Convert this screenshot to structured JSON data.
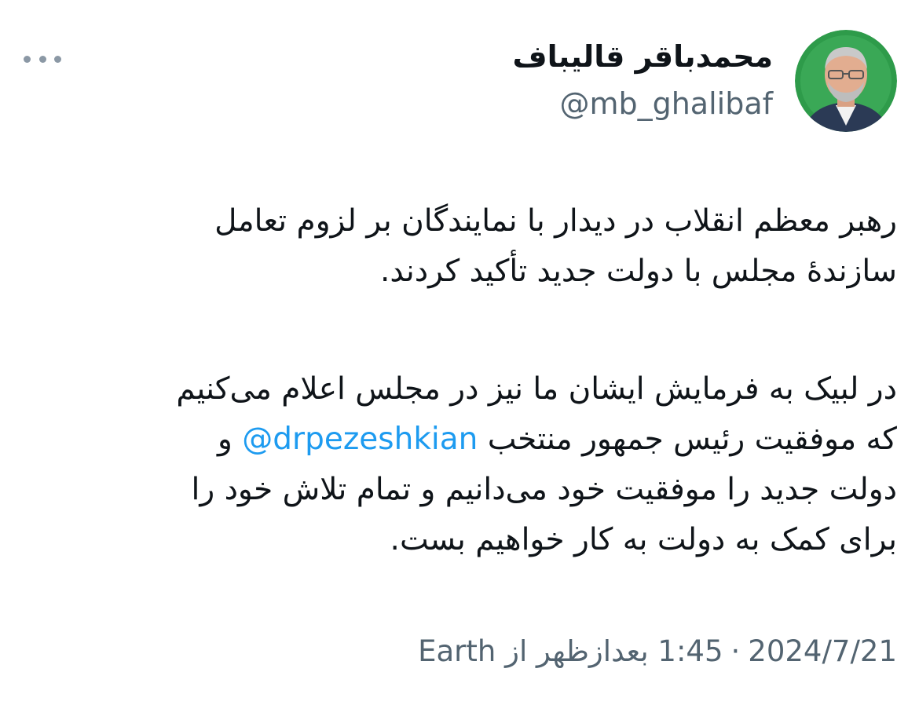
{
  "author": {
    "display_name": "محمدباقر قالیباف",
    "handle": "@mb_ghalibaf",
    "avatar_icon": "profile-photo",
    "avatar_ring_color": "#2e9b4a"
  },
  "menu": {
    "icon": "more-horizontal-icon"
  },
  "tweet": {
    "paragraph1": {
      "line1": "رهبر معظم انقلاب در دیدار با نمایندگان بر لزوم تعامل",
      "line2": "سازندۀ مجلس با دولت جدید تأکید کردند."
    },
    "paragraph2": {
      "line1": "در لبیک به فرمایش ایشان ما نیز در مجلس اعلام می‌کنیم",
      "line2_before": "که موفقیت رئیس جمهور منتخب ",
      "mention": "@drpezeshkian",
      "line2_after": " و",
      "line3": "دولت جدید را موفقیت خود می‌دانیم و تمام تلاش خود را",
      "line4": "برای کمک به دولت به کار خواهیم بست."
    }
  },
  "meta": {
    "date": "2024/7/21",
    "separator": "·",
    "time": "1:45 بعدازظهر",
    "via": "از",
    "source": "Earth"
  },
  "colors": {
    "link": "#1d9bf0",
    "secondary_text": "#536471",
    "primary_text": "#0f1419"
  }
}
